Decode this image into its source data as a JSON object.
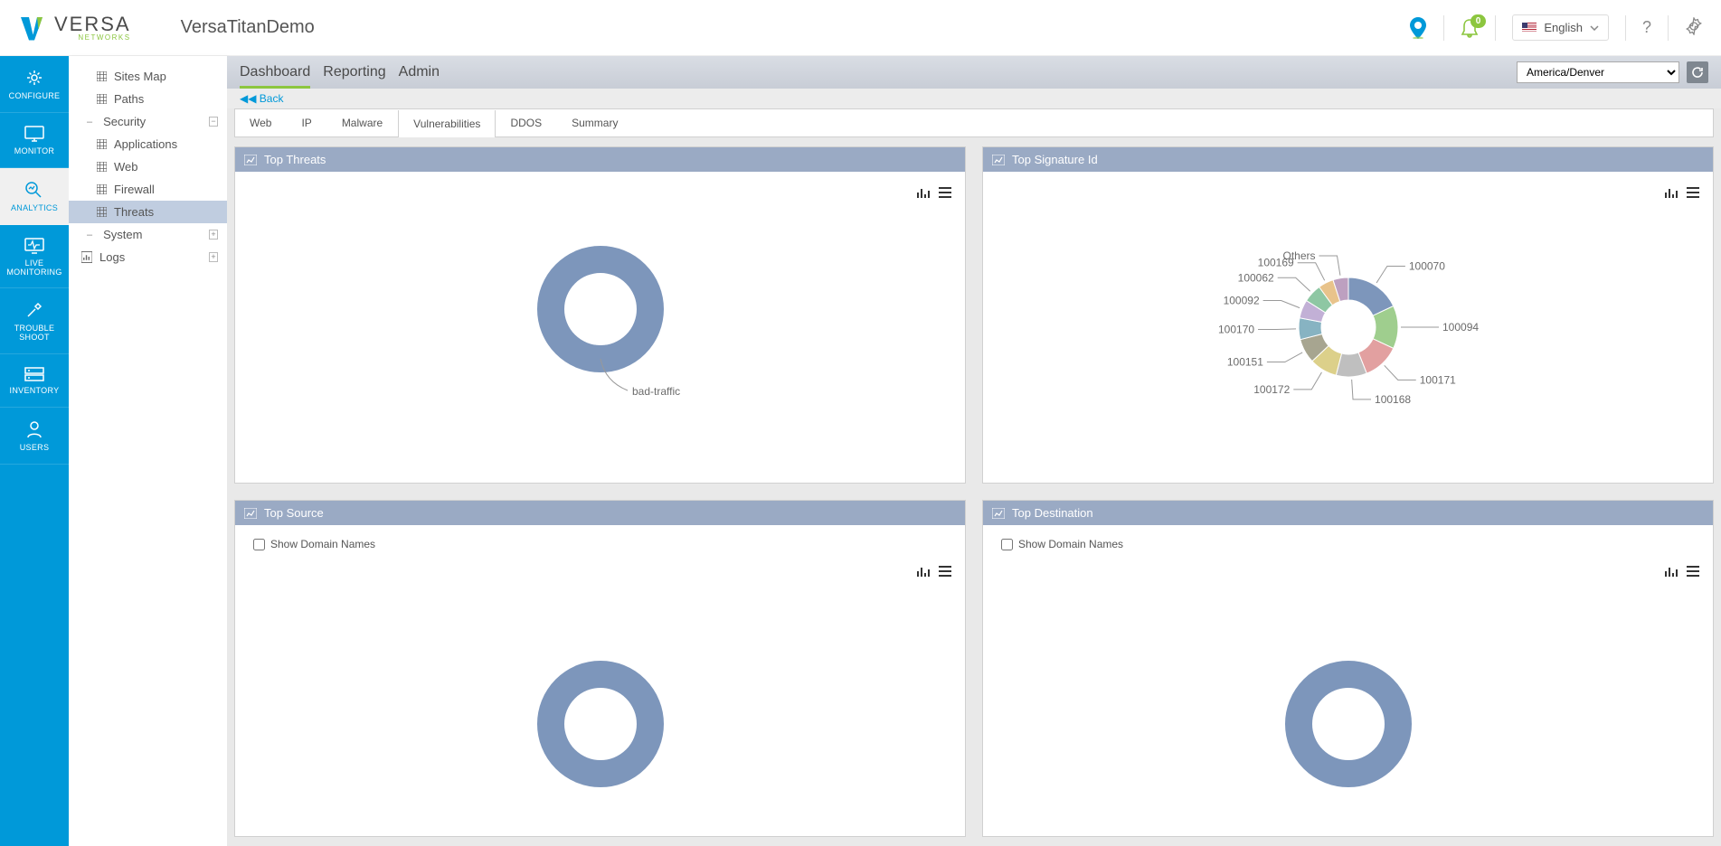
{
  "header": {
    "app_title": "VersaTitanDemo",
    "logo_main": "VERSA",
    "logo_sub": "NETWORKS",
    "notif_count": "0",
    "language": "English",
    "help": "?",
    "timezone": "America/Denver"
  },
  "rail": {
    "items": [
      {
        "id": "configure",
        "label": "CONFIGURE"
      },
      {
        "id": "monitor",
        "label": "MONITOR"
      },
      {
        "id": "analytics",
        "label": "ANALYTICS",
        "active": true
      },
      {
        "id": "live-monitoring",
        "label": "LIVE MONITORING"
      },
      {
        "id": "troubleshoot",
        "label": "TROUBLE SHOOT"
      },
      {
        "id": "inventory",
        "label": "INVENTORY"
      },
      {
        "id": "users",
        "label": "USERS"
      }
    ]
  },
  "sidebar": {
    "items": [
      {
        "type": "leaf",
        "label": "Sites Map",
        "icon": "grid"
      },
      {
        "type": "leaf",
        "label": "Paths",
        "icon": "grid"
      },
      {
        "type": "group",
        "label": "Security",
        "expanded": true,
        "dash": "–",
        "children": [
          {
            "label": "Applications",
            "icon": "grid"
          },
          {
            "label": "Web",
            "icon": "grid"
          },
          {
            "label": "Firewall",
            "icon": "grid"
          },
          {
            "label": "Threats",
            "icon": "grid",
            "active": true
          }
        ]
      },
      {
        "type": "group",
        "label": "System",
        "expanded": false,
        "dash": "–"
      },
      {
        "type": "leaf",
        "label": "Logs",
        "icon": "chart"
      }
    ]
  },
  "main_tabs": {
    "items": [
      {
        "label": "Dashboard",
        "active": true
      },
      {
        "label": "Reporting"
      },
      {
        "label": "Admin"
      }
    ]
  },
  "back_label": "Back",
  "sub_tabs": {
    "items": [
      {
        "label": "Web"
      },
      {
        "label": "IP"
      },
      {
        "label": "Malware"
      },
      {
        "label": "Vulnerabilities",
        "active": true
      },
      {
        "label": "DDOS"
      },
      {
        "label": "Summary"
      }
    ]
  },
  "panels": {
    "top_threats": {
      "title": "Top Threats"
    },
    "top_sigid": {
      "title": "Top Signature Id"
    },
    "top_source": {
      "title": "Top Source",
      "show_dn": "Show Domain Names"
    },
    "top_dest": {
      "title": "Top Destination",
      "show_dn": "Show Domain Names"
    }
  },
  "chart_data": [
    {
      "id": "top_threats",
      "type": "donut",
      "series": [
        {
          "name": "bad-traffic",
          "value": 100,
          "color": "#7d96bb"
        }
      ],
      "labels_visible": [
        "bad-traffic"
      ]
    },
    {
      "id": "top_sigid",
      "type": "donut",
      "series": [
        {
          "name": "100070",
          "value": 18,
          "color": "#7d96bb"
        },
        {
          "name": "100094",
          "value": 14,
          "color": "#9fce8e"
        },
        {
          "name": "100171",
          "value": 12,
          "color": "#e2a0a0"
        },
        {
          "name": "100168",
          "value": 10,
          "color": "#bfbfbf"
        },
        {
          "name": "100172",
          "value": 9,
          "color": "#dcd08a"
        },
        {
          "name": "100151",
          "value": 8,
          "color": "#a7a590"
        },
        {
          "name": "100170",
          "value": 7,
          "color": "#87b3c2"
        },
        {
          "name": "100092",
          "value": 6,
          "color": "#c2b0d6"
        },
        {
          "name": "100062",
          "value": 6,
          "color": "#8ec7a3"
        },
        {
          "name": "100169",
          "value": 5,
          "color": "#e8c38b"
        },
        {
          "name": "Others",
          "value": 5,
          "color": "#bda0c0"
        }
      ],
      "labels_visible": [
        "100070",
        "100094",
        "100171",
        "100168",
        "100172",
        "100151",
        "100170",
        "100092",
        "100062",
        "100169",
        "Others"
      ],
      "note": "values are estimated proportions (%); exact counts not shown in UI"
    },
    {
      "id": "top_source",
      "type": "donut",
      "series": [
        {
          "name": "",
          "value": 100,
          "color": "#7d96bb"
        }
      ],
      "labels_visible": []
    },
    {
      "id": "top_destination",
      "type": "donut",
      "series": [
        {
          "name": "",
          "value": 100,
          "color": "#7d96bb"
        }
      ],
      "labels_visible": []
    }
  ]
}
